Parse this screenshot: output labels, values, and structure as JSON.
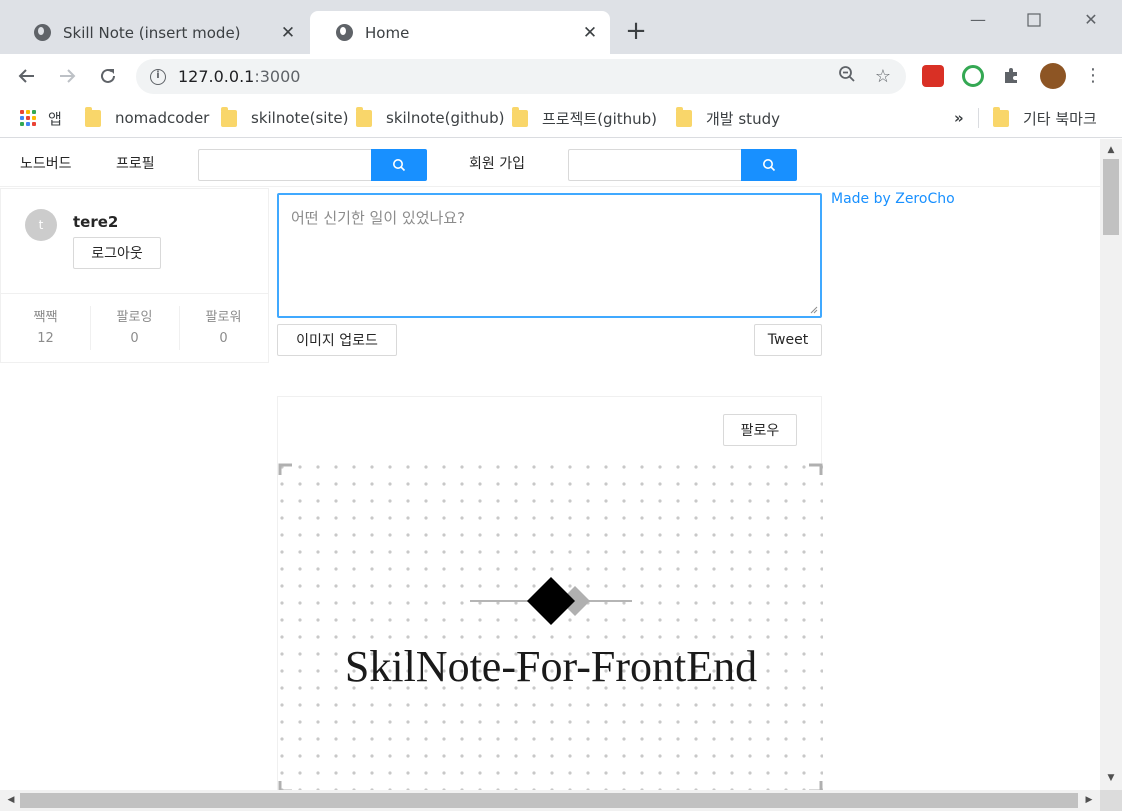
{
  "browser": {
    "tabs": [
      {
        "title": "Skill Note (insert mode)",
        "active": false
      },
      {
        "title": "Home",
        "active": true
      }
    ],
    "new_tab": "+",
    "address": {
      "host": "127.0.0.1",
      "port": ":3000"
    },
    "bookmarks": [
      {
        "label": "앱",
        "icon": "apps-icon"
      },
      {
        "label": "nomadcoder",
        "icon": "folder-icon"
      },
      {
        "label": "skilnote(site)",
        "icon": "folder-icon"
      },
      {
        "label": "skilnote(github)",
        "icon": "folder-icon"
      },
      {
        "label": "프로젝트(github)",
        "icon": "folder-icon"
      },
      {
        "label": "개발 study",
        "icon": "folder-icon"
      }
    ],
    "bookmarks_overflow": "»",
    "other_bookmarks": "기타 북마크"
  },
  "menu": {
    "items": [
      "노드버드",
      "프로필",
      "회원 가입"
    ]
  },
  "user_card": {
    "avatar_letter": "t",
    "nickname": "tere2",
    "logout_label": "로그아웃",
    "stats": [
      {
        "label": "짹짹",
        "count": "12"
      },
      {
        "label": "팔로잉",
        "count": "0"
      },
      {
        "label": "팔로워",
        "count": "0"
      }
    ]
  },
  "post_form": {
    "placeholder": "어떤 신기한 일이 있었나요?",
    "upload_label": "이미지 업로드",
    "submit_label": "Tweet"
  },
  "credit": "Made by ZeroCho",
  "post": {
    "follow_label": "팔로우",
    "image_title": "SkilNote-For-FrontEnd"
  },
  "colors": {
    "primary": "#1890ff",
    "focus_border": "#40a9ff",
    "chrome_tabstrip": "#dee1e6"
  }
}
